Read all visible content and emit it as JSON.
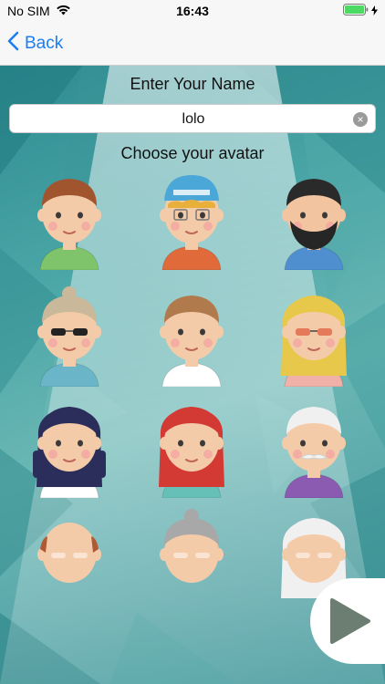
{
  "status": {
    "carrier": "No SIM",
    "time": "16:43"
  },
  "nav": {
    "back_label": "Back"
  },
  "form": {
    "name_title": "Enter Your Name",
    "name_value": "lolo",
    "avatar_title": "Choose your avatar"
  },
  "colors": {
    "accent": "#1a7ef5",
    "battery": "#4cd964",
    "teal_dark": "#2d8b90",
    "teal_light": "#6ab7b4"
  },
  "avatars": [
    {
      "name": "young-man-brown-hair",
      "hair": "#a0552f",
      "skin": "#f4cba9",
      "shirt": "#7fc46a"
    },
    {
      "name": "boy-blue-cap",
      "hair": "#e8b03a",
      "skin": "#f4cba9",
      "shirt": "#e06a3a",
      "cap": "#4ba7d8"
    },
    {
      "name": "man-black-beard",
      "hair": "#2a2a2a",
      "skin": "#f2c4a0",
      "shirt": "#4f8fd0"
    },
    {
      "name": "man-man-bun-sunglasses",
      "hair": "#c9b99a",
      "skin": "#f4cba9",
      "shirt": "#6ab6c8"
    },
    {
      "name": "woman-short-hair",
      "hair": "#b07a4c",
      "skin": "#f4cba9",
      "shirt": "#ffffff"
    },
    {
      "name": "woman-blonde-sunglasses",
      "hair": "#e8c84a",
      "skin": "#f4cba9",
      "shirt": "#f2b1a8"
    },
    {
      "name": "girl-black-braids",
      "hair": "#2b2d5a",
      "skin": "#f4cba9",
      "shirt": "#ffffff"
    },
    {
      "name": "woman-red-hair",
      "hair": "#d33a34",
      "skin": "#f4cba9",
      "shirt": "#66c0b8"
    },
    {
      "name": "grandpa-mustache",
      "hair": "#f0f0f0",
      "skin": "#f4cba9",
      "shirt": "#8a5bb0"
    },
    {
      "name": "bald-man",
      "hair": "#b05a35",
      "skin": "#f4cba9",
      "shirt": "#ffffff"
    },
    {
      "name": "grandma-gray-bun",
      "hair": "#a8a8a8",
      "skin": "#f4cba9",
      "shirt": "#ffffff"
    },
    {
      "name": "grandma-white-hair",
      "hair": "#f0f0f0",
      "skin": "#f4cba9",
      "shirt": "#ffffff"
    }
  ]
}
